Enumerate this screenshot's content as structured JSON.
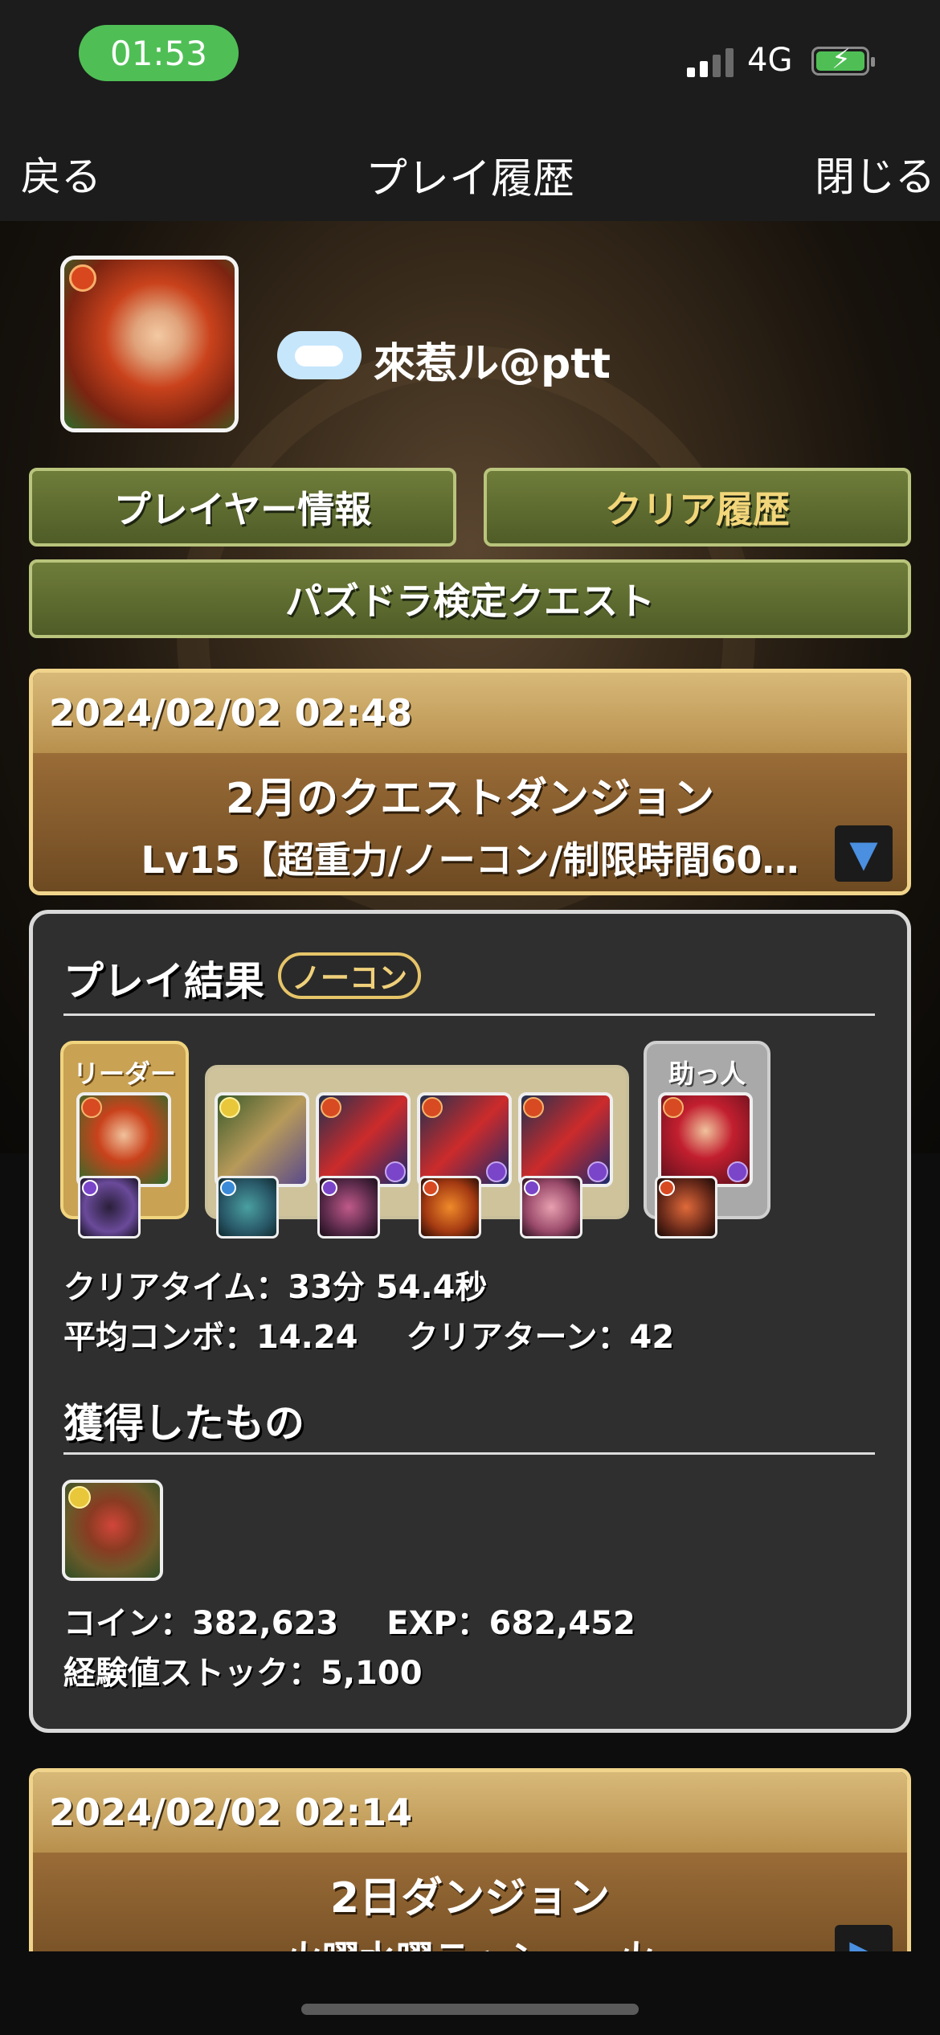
{
  "status_bar": {
    "time": "01:53",
    "network": "4G"
  },
  "nav": {
    "back": "戻る",
    "title": "プレイ履歴",
    "close": "閉じる"
  },
  "profile": {
    "name": "來惹ル@ptt"
  },
  "tabs": {
    "player_info": "プレイヤー情報",
    "clear_history": "クリア履歴",
    "quest": "パズドラ検定クエスト"
  },
  "entries": [
    {
      "datetime": "2024/02/02 02:48",
      "title": "2月のクエストダンジョン",
      "subtitle": "Lv15【超重力/ノーコン/制限時間60…"
    },
    {
      "datetime": "2024/02/02 02:14",
      "title": "2日ダンジョン",
      "subtitle": "火曜水曜ラッシュ・火"
    }
  ],
  "result": {
    "heading": "プレイ結果",
    "badge": "ノーコン",
    "leader_label": "リーダー",
    "helper_label": "助っ人",
    "clear_time": "クリアタイム：33分 54.4秒",
    "avg_combo": "平均コンボ：14.24",
    "clear_turns": "クリアターン：42",
    "obtained_heading": "獲得したもの",
    "coins": "コイン：382,623",
    "exp": "EXP：682,452",
    "exp_stock": "経験値ストック：5,100"
  },
  "colors": {
    "accent_green": "#6f7d3a",
    "gold": "#f0d48b",
    "status_green": "#4fbf55"
  },
  "icons": {
    "expand": "triangle-down-icon",
    "expand_right": "triangle-right-icon"
  }
}
